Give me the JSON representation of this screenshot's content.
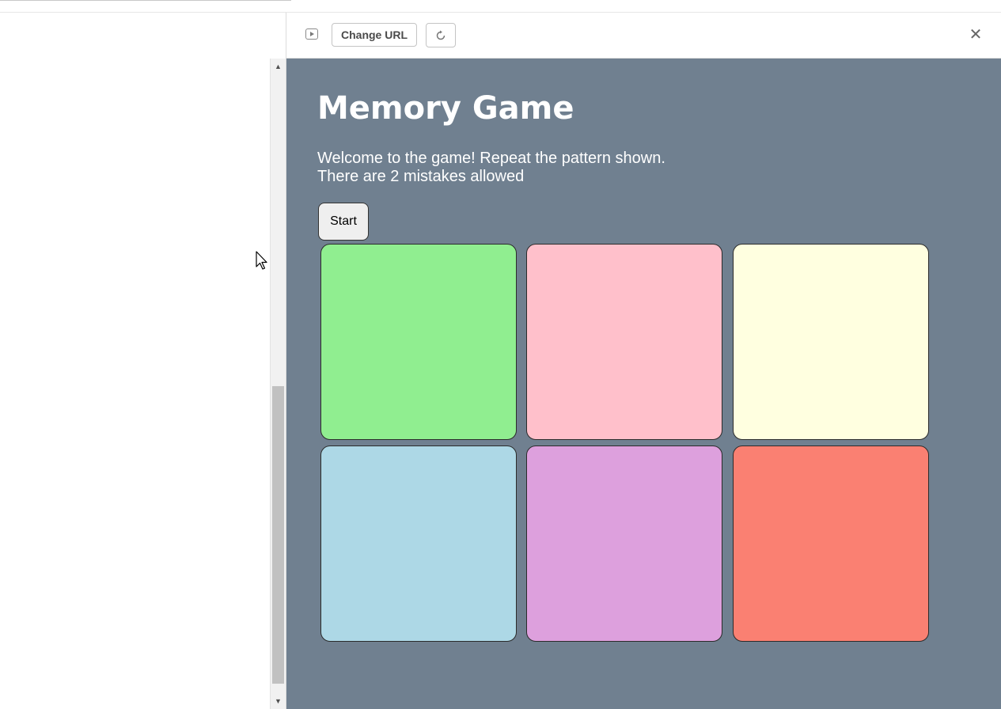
{
  "toolbar": {
    "change_url_label": "Change URL"
  },
  "game": {
    "title": "Memory Game",
    "description_line1": "Welcome to the game! Repeat the pattern shown.",
    "description_line2": "There are 2 mistakes allowed",
    "start_label": "Start",
    "background_color": "#708090",
    "tiles": [
      {
        "color": "#90ee90"
      },
      {
        "color": "#ffc0cb"
      },
      {
        "color": "#ffffe0"
      },
      {
        "color": "#add8e6"
      },
      {
        "color": "#dda0dd"
      },
      {
        "color": "#fa8072"
      }
    ]
  },
  "icons": {
    "run": "play-icon",
    "refresh": "refresh-icon",
    "close": "close-icon",
    "cursor": "mouse-cursor-icon"
  }
}
